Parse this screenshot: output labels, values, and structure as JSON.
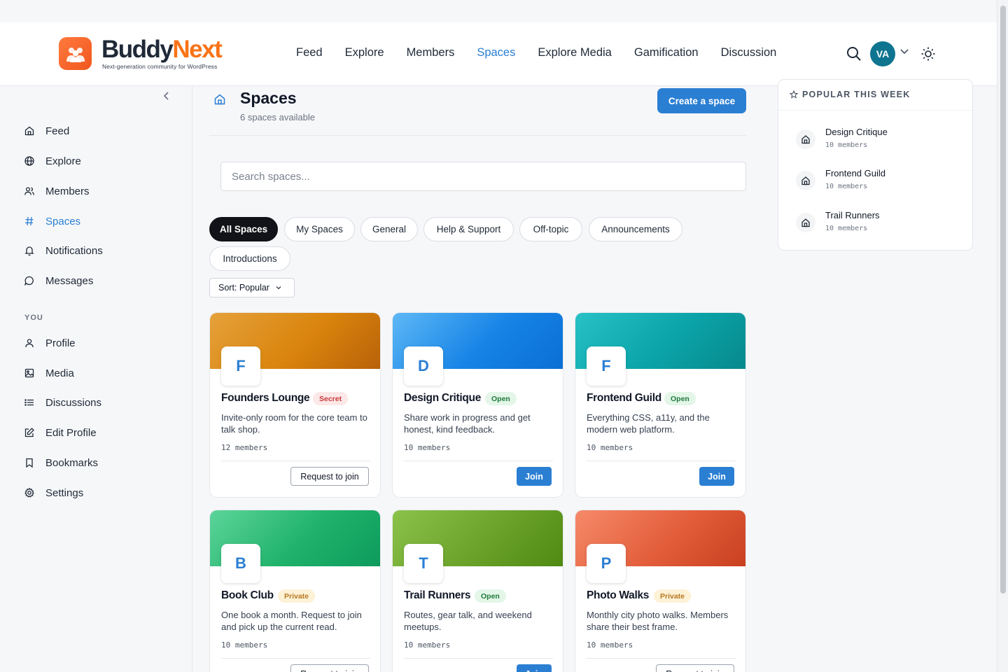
{
  "brand": {
    "name_part1": "Buddy",
    "name_part2": "Next",
    "tagline": "Next-generation community for WordPress"
  },
  "nav": {
    "items": [
      "Feed",
      "Explore",
      "Members",
      "Spaces",
      "Explore Media",
      "Gamification",
      "Discussion"
    ],
    "active": "Spaces"
  },
  "user": {
    "initials": "VA"
  },
  "sidebar": {
    "items": [
      "Feed",
      "Explore",
      "Members",
      "Spaces",
      "Notifications",
      "Messages"
    ],
    "section_label": "YOU",
    "you_items": [
      "Profile",
      "Media",
      "Discussions",
      "Edit Profile",
      "Bookmarks",
      "Settings"
    ],
    "active": "Spaces"
  },
  "page": {
    "title": "Spaces",
    "subtitle": "6 spaces available",
    "create_label": "Create a space"
  },
  "search": {
    "placeholder": "Search spaces..."
  },
  "filters": {
    "chips": [
      "All Spaces",
      "My Spaces",
      "General",
      "Help & Support",
      "Off-topic",
      "Announcements",
      "Introductions"
    ],
    "active": "All Spaces"
  },
  "sort": {
    "label": "Sort: Popular"
  },
  "spaces": [
    {
      "initial": "F",
      "name": "Founders Lounge",
      "badge": "Secret",
      "description": "Invite-only room for the core team to talk shop.",
      "members": "12 members",
      "action": "Request to join"
    },
    {
      "initial": "D",
      "name": "Design Critique",
      "badge": "Open",
      "description": "Share work in progress and get honest, kind feedback.",
      "members": "10 members",
      "action": "Join"
    },
    {
      "initial": "F",
      "name": "Frontend Guild",
      "badge": "Open",
      "description": "Everything CSS, a11y, and the modern web platform.",
      "members": "10 members",
      "action": "Join"
    },
    {
      "initial": "B",
      "name": "Book Club",
      "badge": "Private",
      "description": "One book a month. Request to join and pick up the current read.",
      "members": "10 members",
      "action": "Request to join"
    },
    {
      "initial": "T",
      "name": "Trail Runners",
      "badge": "Open",
      "description": "Routes, gear talk, and weekend meetups.",
      "members": "10 members",
      "action": "Join"
    },
    {
      "initial": "P",
      "name": "Photo Walks",
      "badge": "Private",
      "description": "Monthly city photo walks. Members share their best frame.",
      "members": "10 members",
      "action": "Request to join"
    }
  ],
  "popular": {
    "title": "POPULAR THIS WEEK",
    "items": [
      {
        "name": "Design Critique",
        "members": "10 members"
      },
      {
        "name": "Frontend Guild",
        "members": "10 members"
      },
      {
        "name": "Trail Runners",
        "members": "10 members"
      }
    ]
  },
  "colors": {
    "accent": "#2b7fd3",
    "brand_orange": "#f97316",
    "avatar": "#0e7490"
  }
}
